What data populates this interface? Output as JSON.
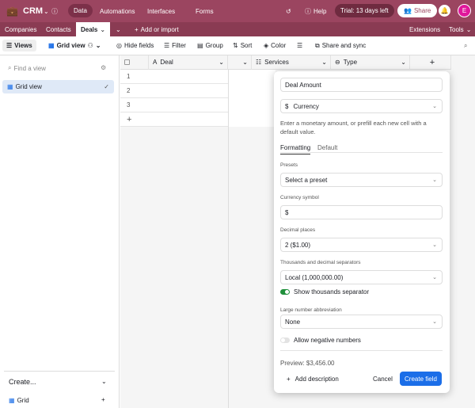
{
  "topbar": {
    "app_name": "CRM",
    "nav": [
      "Data",
      "Automations",
      "Interfaces",
      "Forms"
    ],
    "help": "Help",
    "trial": "Trial: 13 days left",
    "share": "Share",
    "avatar": "E"
  },
  "tabs": {
    "items": [
      "Companies",
      "Contacts",
      "Deals"
    ],
    "add": "Add or import",
    "extensions": "Extensions",
    "tools": "Tools"
  },
  "toolbar": {
    "views": "Views",
    "grid_view": "Grid view",
    "hide_fields": "Hide fields",
    "filter": "Filter",
    "group": "Group",
    "sort": "Sort",
    "color": "Color",
    "share_sync": "Share and sync"
  },
  "sidebar": {
    "search_placeholder": "Find a view",
    "active_view": "Grid view",
    "create": "Create...",
    "create_grid": "Grid"
  },
  "grid": {
    "columns": [
      "Deal",
      "Services",
      "Type"
    ],
    "rows": [
      "1",
      "2",
      "3"
    ]
  },
  "popup": {
    "field_name": "Deal Amount",
    "field_type": "Currency",
    "description": "Enter a monetary amount, or prefill each new cell with a default value.",
    "tabs": [
      "Formatting",
      "Default"
    ],
    "presets_label": "Presets",
    "presets_value": "Select a preset",
    "currency_symbol_label": "Currency symbol",
    "currency_symbol": "$",
    "decimal_label": "Decimal places",
    "decimal_value": "2 ($1.00)",
    "separators_label": "Thousands and decimal separators",
    "separators_value": "Local (1,000,000.00)",
    "show_separator": "Show thousands separator",
    "large_label": "Large number abbreviation",
    "large_value": "None",
    "allow_negative": "Allow negative numbers",
    "preview": "Preview: $3,456.00",
    "add_description": "Add description",
    "cancel": "Cancel",
    "create": "Create field"
  },
  "colors": {
    "brand": "#9b4560",
    "primary": "#1b6ee8",
    "toggle_on": "#1f8f3a"
  }
}
